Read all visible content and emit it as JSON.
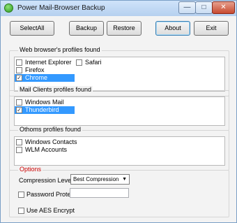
{
  "window": {
    "title": "Power Mail-Browser Backup"
  },
  "caption_buttons": {
    "minimize": "—",
    "maximize": "□",
    "close": "✕"
  },
  "toolbar": {
    "select_all": "SelectAll",
    "backup": "Backup",
    "restore": "Restore",
    "about": "About",
    "exit": "Exit"
  },
  "browsers": {
    "label": "Web browser's profiles found",
    "items": [
      {
        "label": "Internet Explorer",
        "checked": false,
        "selected": false
      },
      {
        "label": "Safari",
        "checked": false,
        "selected": false
      },
      {
        "label": "Firefox",
        "checked": false,
        "selected": false
      },
      {
        "label": "Chrome",
        "checked": true,
        "selected": true
      }
    ]
  },
  "mail": {
    "label": "Mail Clients profiles found",
    "items": [
      {
        "label": "Windows Mail",
        "checked": false,
        "selected": false
      },
      {
        "label": "Thunderbird",
        "checked": true,
        "selected": true
      }
    ]
  },
  "others": {
    "label": "Othoms profiles found",
    "items": [
      {
        "label": "Windows Contacts",
        "checked": false,
        "selected": false
      },
      {
        "label": "WLM Accounts",
        "checked": false,
        "selected": false
      }
    ]
  },
  "options": {
    "label": "Options",
    "label_color": "#cc0000",
    "compression_label": "Compression Level:",
    "compression_value": "Best Compression",
    "password_label": "Password Protect",
    "password_value": "",
    "password_checked": false,
    "aes_label": "Use AES Encrypt",
    "aes_checked": false
  },
  "colors": {
    "selection": "#3399ff",
    "options_label": "#cc0000"
  }
}
